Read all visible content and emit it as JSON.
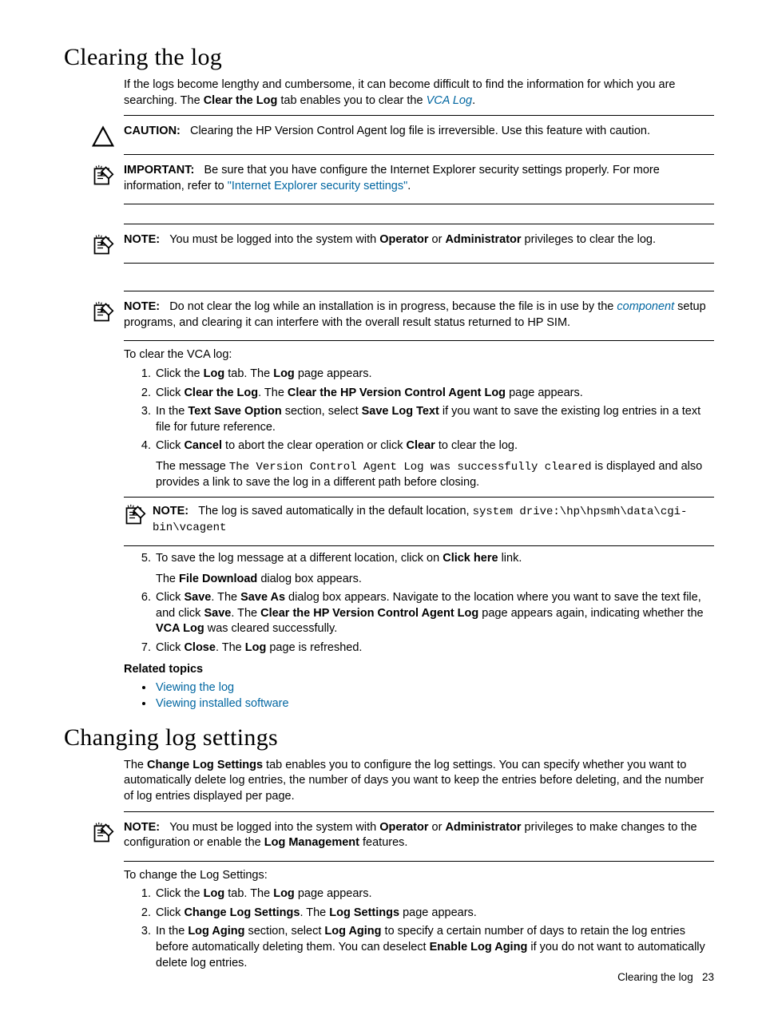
{
  "section1": {
    "title": "Clearing the log",
    "intro_part1": "If the logs become lengthy and cumbersome, it can become difficult to find the information for which you are searching. The ",
    "intro_bold1": "Clear the Log",
    "intro_part2": " tab enables you to clear the ",
    "intro_link1": "VCA Log",
    "intro_part3": ".",
    "caution_label": "CAUTION:",
    "caution_text": "Clearing the HP Version Control Agent log file is irreversible. Use this feature with caution.",
    "important_label": "IMPORTANT:",
    "important_text1": "Be sure that you have configure the Internet Explorer security settings properly. For more information, refer to ",
    "important_link": "\"Internet Explorer security settings\"",
    "important_text2": ".",
    "note1_label": "NOTE:",
    "note1_a": "You must be logged into the system with ",
    "note1_b": "Operator",
    "note1_c": " or ",
    "note1_d": "Administrator",
    "note1_e": " privileges to clear the log.",
    "note2_label": "NOTE:",
    "note2_a": "Do not clear the log while an installation is in progress, because the file is in use by the ",
    "note2_link": "component",
    "note2_b": " setup programs, and clearing it can interfere with the overall result status returned to HP SIM.",
    "to_clear": "To clear the VCA log:",
    "steps": {
      "s1a": "Click the ",
      "s1b": "Log",
      "s1c": " tab. The ",
      "s1d": "Log",
      "s1e": " page appears.",
      "s2a": "Click ",
      "s2b": "Clear the Log",
      "s2c": ". The ",
      "s2d": "Clear the HP Version Control Agent Log",
      "s2e": " page appears.",
      "s3a": "In the ",
      "s3b": "Text Save Option",
      "s3c": " section, select ",
      "s3d": "Save Log Text",
      "s3e": " if you want to save the existing log entries in a text file for future reference.",
      "s4a": "Click ",
      "s4b": "Cancel",
      "s4c": " to abort the clear operation or click ",
      "s4d": "Clear",
      "s4e": " to clear the log.",
      "s4msg_a": "The message ",
      "s4msg_code": "The Version Control Agent Log was successfully cleared",
      "s4msg_b": " is displayed and also provides a link to save the log in a different path before closing.",
      "innernote_label": "NOTE:",
      "innernote_a": "The log is saved automatically in the default location, ",
      "innernote_code1": "system drive:\\hp\\hpsmh\\data\\cgi-bin\\vcagent",
      "s5a": "To save the log message at a different location, click on ",
      "s5b": "Click here",
      "s5c": " link.",
      "s5sub_a": "The ",
      "s5sub_b": "File Download",
      "s5sub_c": " dialog box appears.",
      "s6a": "Click ",
      "s6b": "Save",
      "s6c": ". The ",
      "s6d": "Save As",
      "s6e": " dialog box appears. Navigate to the location where you want to save the text file, and click ",
      "s6f": "Save",
      "s6g": ". The ",
      "s6h": "Clear the HP Version Control Agent Log",
      "s6i": " page appears again, indicating whether the ",
      "s6j": "VCA Log",
      "s6k": " was cleared successfully.",
      "s7a": "Click ",
      "s7b": "Close",
      "s7c": ". The ",
      "s7d": "Log",
      "s7e": " page is refreshed."
    },
    "related_heading": "Related topics",
    "related1": "Viewing the log",
    "related2": "Viewing installed software"
  },
  "section2": {
    "title": "Changing log settings",
    "intro_a": "The ",
    "intro_b": "Change Log Settings",
    "intro_c": " tab enables you to configure the log settings. You can specify whether you want to automatically delete log entries, the number of days you want to keep the entries before deleting, and the number of log entries displayed per page.",
    "note_label": "NOTE:",
    "note_a": "You must be logged into the system with ",
    "note_b": "Operator",
    "note_c": " or ",
    "note_d": "Administrator",
    "note_e": " privileges to make changes to the configuration or enable the ",
    "note_f": "Log Management",
    "note_g": " features.",
    "to_change": "To change the Log Settings:",
    "steps": {
      "s1a": "Click the ",
      "s1b": "Log",
      "s1c": " tab. The ",
      "s1d": "Log",
      "s1e": " page appears.",
      "s2a": "Click ",
      "s2b": "Change Log Settings",
      "s2c": ". The ",
      "s2d": "Log Settings",
      "s2e": " page appears.",
      "s3a": "In the ",
      "s3b": "Log Aging",
      "s3c": " section, select ",
      "s3d": "Log Aging",
      "s3e": " to specify a certain number of days to retain the log entries before automatically deleting them. You can deselect ",
      "s3f": "Enable Log Aging",
      "s3g": " if you do not want to automatically delete log entries."
    }
  },
  "footer": {
    "text": "Clearing the log",
    "page": "23"
  }
}
